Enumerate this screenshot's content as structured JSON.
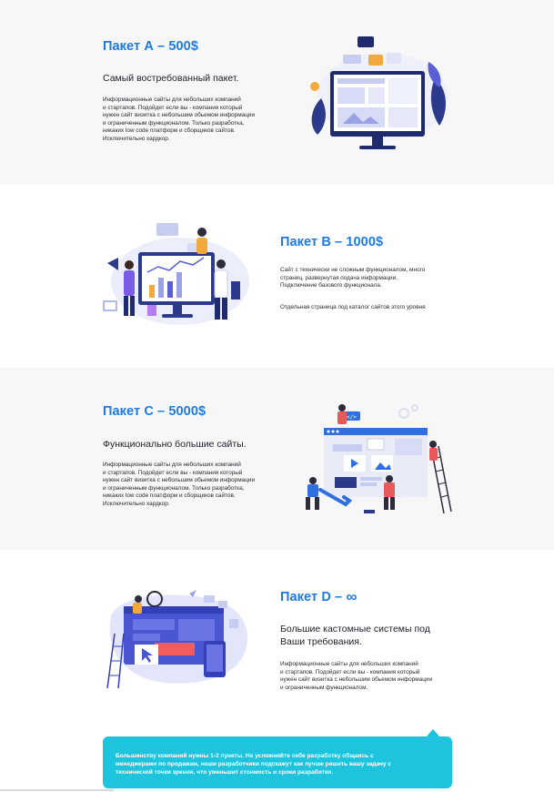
{
  "package_a": {
    "title": "Пакет А – 500$",
    "subtitle": "Самый востребованный пакет.",
    "body": "Информационные сайты для небольших компаний\nи стартапов. Подойдет если вы - компания который\nнужен сайт визитка с небольшим обьемом информации\nи ограниченным функционалом. Только разработка,\nникаких low code платформ и сборщиков сайтов.\nИсключительно хардкор."
  },
  "package_b": {
    "title": "Пакет B – 1000$",
    "body": "Сайт с технически не сложным функционалом, много\nстраниц, развернутая подача информации.\nПодключение базового функционала.",
    "body2": "Отдельная страница под каталог сайтов этого уровня"
  },
  "package_c": {
    "title": "Пакет С – 5000$",
    "subtitle": "Функционально большие сайты.",
    "body": "Информационные сайты для небольших компаний\nи стартапов. Подойдет если вы - компания который\nнужен сайт визитка с небольшим обьемом информации\nи ограниченным функционалом. Только разработка,\nникаких low code платформ и сборщиков сайтов.\nИсключительно хардкор."
  },
  "package_d": {
    "title": "Пакет D –",
    "title_symbol": "∞",
    "subtitle": "Большие кастомные системы под\nВаши требования.",
    "body": "Информационные сайты для небольших компаний\nи стартапов. Подойдет если вы - компания который\nнужен сайт визитка с небольшим обьемом информации\nи ограниченным функционалом."
  },
  "banner": {
    "text": "Большинству компаний нужны 1-2 пункты. Не усложняйте себе разработку общаясь с\nменеджерами по продажам, наши разработчики подскажут как лучше решить вашу задачу с\nтехнической точки зрения, что уменьшит стоимость и сроки разработки."
  },
  "colors": {
    "accent_blue": "#1e7be6",
    "banner_cyan": "#1ec3de",
    "illustration_navy": "#1f2b6e",
    "illustration_purple": "#5a5fd6"
  },
  "icons": {
    "a": "monitor-dashboard-illustration",
    "b": "analytics-team-illustration",
    "c": "web-builders-illustration",
    "d": "ui-design-illustration"
  }
}
